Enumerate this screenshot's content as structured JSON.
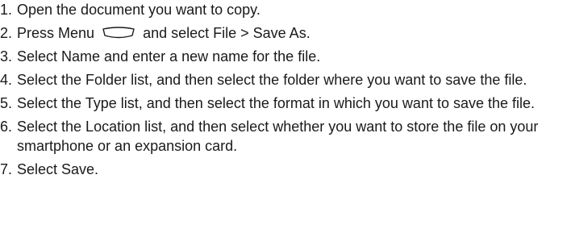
{
  "steps": [
    {
      "num": "1.",
      "text": "Open the document you want to copy."
    },
    {
      "num": "2.",
      "text_before": "Press Menu",
      "icon": "menu-key-icon",
      "text_after": "and select File > Save As."
    },
    {
      "num": "3.",
      "text": "Select Name and enter a new name for the file."
    },
    {
      "num": "4.",
      "text": "Select the Folder list, and then select the folder where you want to save the file."
    },
    {
      "num": "5.",
      "text": "Select the Type list, and then select the format in which you want to save the file."
    },
    {
      "num": "6.",
      "text": "Select the Location list, and then select whether you want to store the file on your smartphone or an expansion card."
    },
    {
      "num": "7.",
      "text": "Select Save."
    }
  ]
}
